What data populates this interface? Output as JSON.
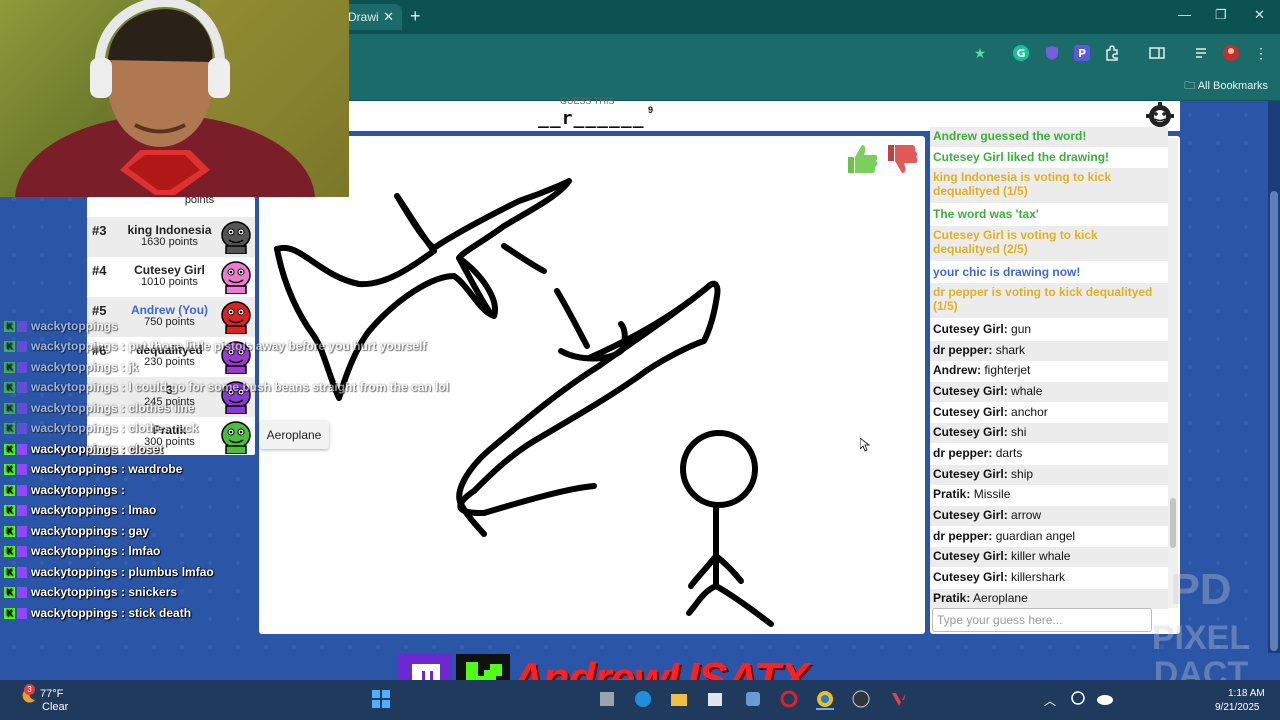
{
  "browser": {
    "tab_title": "Drawi",
    "bookmarks_label": "All Bookmarks",
    "window_min": "—",
    "window_max": "❐",
    "window_close": "✕",
    "new_tab": "+",
    "tab_close": "✕"
  },
  "game": {
    "hint_label": "GUESS THIS",
    "word_pattern": "__r______",
    "word_length": "9",
    "thumbs_up": "👍",
    "thumbs_down": "👎"
  },
  "players": [
    {
      "rank": "",
      "name": "",
      "points": "points",
      "color": "#ffffff"
    },
    {
      "rank": "#3",
      "name": "king Indonesia",
      "points": "1630 points",
      "color": "#555555"
    },
    {
      "rank": "#4",
      "name": "Cutesey Girl",
      "points": "1010 points",
      "color": "#f07ad0"
    },
    {
      "rank": "#5",
      "name": "Andrew (You)",
      "points": "750 points",
      "color": "#dd2222"
    },
    {
      "rank": "#6",
      "name": "dequalityed",
      "points": "230 points",
      "color": "#9a3ad0"
    },
    {
      "rank": "",
      "name": "3",
      "points": "245 points",
      "color": "#8a3ad0"
    },
    {
      "rank": "",
      "name": "Pratik",
      "points": "300 points",
      "color": "#4ac03a"
    }
  ],
  "tooltip": "Aeroplane",
  "chat": [
    {
      "type": "system",
      "color": "#3ab03a",
      "text": "Andrew guessed the word!"
    },
    {
      "type": "system",
      "color": "#3ab03a",
      "text": "Cutesey Girl liked the drawing!"
    },
    {
      "type": "system",
      "color": "#e0b020",
      "text": "king Indonesia is voting to kick dequalityed (1/5)"
    },
    {
      "type": "system",
      "color": "#3ab03a",
      "text": "The word was 'tax'"
    },
    {
      "type": "system",
      "color": "#e0b020",
      "text": "Cutesey Girl is voting to kick dequalityed (2/5)"
    },
    {
      "type": "system",
      "color": "#3a6ad0",
      "text": "your chic is drawing now!"
    },
    {
      "type": "system",
      "color": "#e0b020",
      "text": "dr pepper is voting to kick dequalityed (1/5)"
    },
    {
      "type": "guess",
      "name": "Cutesey Girl:",
      "text": "gun"
    },
    {
      "type": "guess",
      "name": "dr pepper:",
      "text": "shark"
    },
    {
      "type": "guess",
      "name": "Andrew:",
      "text": "fighterjet"
    },
    {
      "type": "guess",
      "name": "Cutesey Girl:",
      "text": "whale"
    },
    {
      "type": "guess",
      "name": "Cutesey Girl:",
      "text": "anchor"
    },
    {
      "type": "guess",
      "name": "Cutesey Girl:",
      "text": "shi"
    },
    {
      "type": "guess",
      "name": "dr pepper:",
      "text": "darts"
    },
    {
      "type": "guess",
      "name": "Cutesey Girl:",
      "text": "ship"
    },
    {
      "type": "guess",
      "name": "Pratik:",
      "text": "Missile"
    },
    {
      "type": "guess",
      "name": "Cutesey Girl:",
      "text": "arrow"
    },
    {
      "type": "guess",
      "name": "dr pepper:",
      "text": "guardian angel"
    },
    {
      "type": "guess",
      "name": "Cutesey Girl:",
      "text": "killer whale"
    },
    {
      "type": "guess",
      "name": "Cutesey Girl:",
      "text": "killershark"
    },
    {
      "type": "guess",
      "name": "Pratik:",
      "text": "Aeroplane"
    }
  ],
  "guess_placeholder": "Type your guess here...",
  "stream_chat": [
    {
      "user": "wackytoppings",
      "text": ": put those little pistols away before you hurt yourself",
      "ghost": true
    },
    {
      "user": "wackytoppings",
      "text": ": jk",
      "ghost": true
    },
    {
      "user": "wackytoppings",
      "text": ": I could go for some bush beans straight from the can lol",
      "ghost": true
    },
    {
      "user": "wackytoppings",
      "text": ": clothes line",
      "ghost": true
    },
    {
      "user": "wackytoppings",
      "text": ": clothes rack",
      "ghost": true
    },
    {
      "user": "wackytoppings",
      "text": ": closet",
      "ghost": false
    },
    {
      "user": "wackytoppings",
      "text": ": wardrobe",
      "ghost": false
    },
    {
      "user": "wackytoppings",
      "text": ":",
      "ghost": false
    },
    {
      "user": "wackytoppings",
      "text": ": lmao",
      "ghost": false
    },
    {
      "user": "wackytoppings",
      "text": ": gay",
      "ghost": false
    },
    {
      "user": "wackytoppings",
      "text": ": lmfao",
      "ghost": false
    },
    {
      "user": "wackytoppings",
      "text": ": plumbus lmfao",
      "ghost": false
    },
    {
      "user": "wackytoppings",
      "text": ": snickers",
      "ghost": false
    },
    {
      "user": "wackytoppings",
      "text": ": stick death",
      "ghost": false
    }
  ],
  "stream_chat_top": "wackytoppings",
  "overlay": {
    "brand_name": "AndrewUSATX",
    "watermark_top": "PD",
    "watermark_bottom": "PIXEL DACT"
  },
  "taskbar": {
    "weather_badge": "3",
    "weather_temp": "77°F",
    "weather_condition": "Clear",
    "time": "1:18 AM",
    "date": "9/21/2025"
  }
}
